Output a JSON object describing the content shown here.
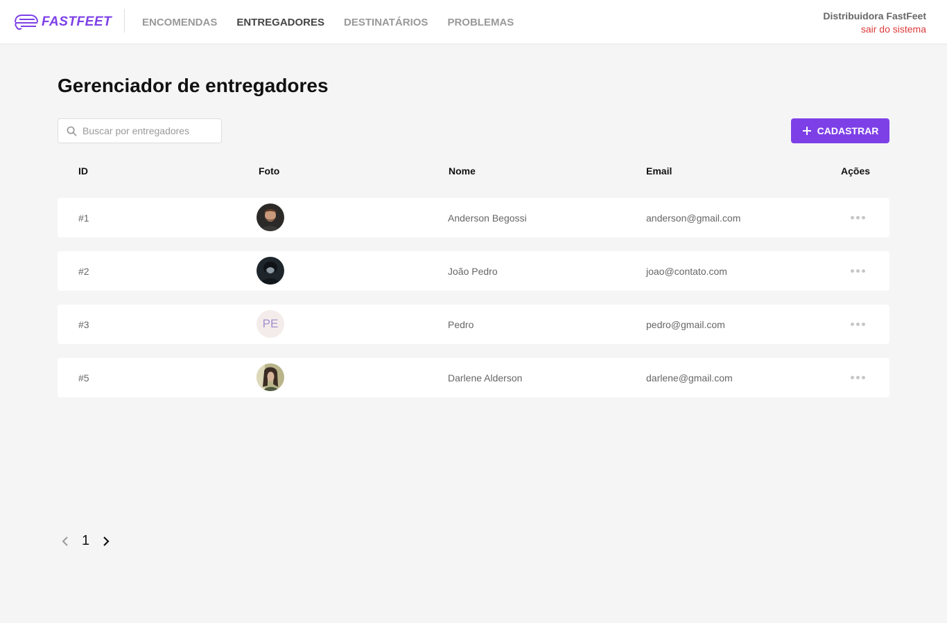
{
  "header": {
    "logo_text": "FASTFEET",
    "nav": [
      {
        "label": "ENCOMENDAS",
        "active": false
      },
      {
        "label": "ENTREGADORES",
        "active": true
      },
      {
        "label": "DESTINATÁRIOS",
        "active": false
      },
      {
        "label": "PROBLEMAS",
        "active": false
      }
    ],
    "user_name": "Distribuidora FastFeet",
    "logout_label": "sair do sistema"
  },
  "page": {
    "title": "Gerenciador de entregadores",
    "search_placeholder": "Buscar por entregadores",
    "search_value": "",
    "add_button_label": "CADASTRAR"
  },
  "table": {
    "columns": [
      "ID",
      "Foto",
      "Nome",
      "Email",
      "Ações"
    ],
    "rows": [
      {
        "id": "#1",
        "photo": "photo",
        "name": "Anderson Begossi",
        "email": "anderson@gmail.com"
      },
      {
        "id": "#2",
        "photo": "photo",
        "name": "João Pedro",
        "email": "joao@contato.com"
      },
      {
        "id": "#3",
        "photo": "initials",
        "initials": "PE",
        "name": "Pedro",
        "email": "pedro@gmail.com"
      },
      {
        "id": "#5",
        "photo": "photo",
        "name": "Darlene Alderson",
        "email": "darlene@gmail.com"
      }
    ]
  },
  "pagination": {
    "current_page": "1"
  },
  "colors": {
    "brand": "#7d40e7",
    "logout": "#de3b3b",
    "background": "#f5f5f5",
    "initials_bg": "#f4ecea",
    "initials_text": "#a28fd0"
  },
  "icons": {
    "search": "search-icon",
    "add": "plus-icon",
    "actions": "more-horizontal-icon",
    "prev": "chevron-left-icon",
    "next": "chevron-right-icon"
  }
}
